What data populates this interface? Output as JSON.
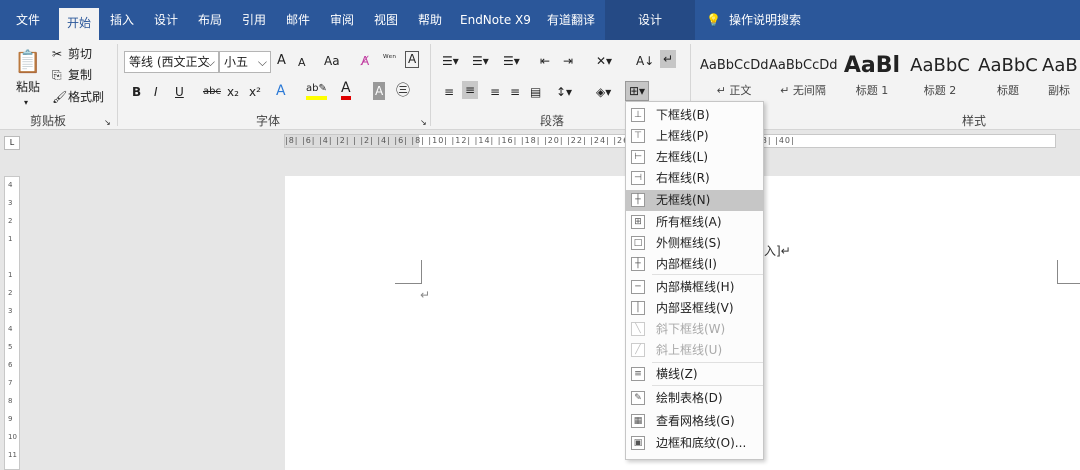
{
  "tabs": [
    "文件",
    "开始",
    "插入",
    "设计",
    "布局",
    "引用",
    "邮件",
    "审阅",
    "视图",
    "帮助",
    "EndNote X9",
    "有道翻译"
  ],
  "active_tab": "开始",
  "context_tab": "设计",
  "tell_me": "操作说明搜索",
  "clipboard": {
    "paste": "粘贴",
    "cut": "剪切",
    "copy": "复制",
    "format_painter": "格式刷",
    "label": "剪贴板"
  },
  "font": {
    "name": "等线 (西文正文",
    "size": "小五",
    "grow": "A",
    "shrink": "A",
    "case": "Aa",
    "bold": "B",
    "italic": "I",
    "underline": "U",
    "strike": "abc",
    "sub": "x₂",
    "sup": "x²",
    "label": "字体"
  },
  "paragraph": {
    "label": "段落"
  },
  "styles": {
    "items": [
      {
        "sample": "AaBbCcDd",
        "name": "↵ 正文"
      },
      {
        "sample": "AaBbCcDd",
        "name": "↵ 无间隔"
      },
      {
        "sample": "AaBl",
        "name": "标题 1"
      },
      {
        "sample": "AaBbC",
        "name": "标题 2"
      },
      {
        "sample": "AaBbC",
        "name": "标题"
      },
      {
        "sample": "AaB",
        "name": "副标"
      }
    ],
    "label": "样式"
  },
  "ruler": {
    "marks": "|8| |6| |4| |2| |  |2| |4| |6| |8| |10| |12| |14| |16| |18| |20| |22| |24| |26| |28| |30| |32| |34| |36| |38| |40|"
  },
  "vruler": {
    "marks": [
      "4",
      "3",
      "2",
      "1",
      "",
      "1",
      "2",
      "3",
      "4",
      "5",
      "6",
      "7",
      "8",
      "9",
      "10",
      "11"
    ]
  },
  "document": {
    "para1": "↵",
    "fragment": "入]↵"
  },
  "border_menu": {
    "items": [
      {
        "label": "下框线(B)",
        "icon": "bottom-border-icon",
        "state": "normal"
      },
      {
        "label": "上框线(P)",
        "icon": "top-border-icon",
        "state": "normal"
      },
      {
        "label": "左框线(L)",
        "icon": "left-border-icon",
        "state": "normal"
      },
      {
        "label": "右框线(R)",
        "icon": "right-border-icon",
        "state": "normal"
      },
      {
        "label": "无框线(N)",
        "icon": "no-border-icon",
        "state": "highlighted"
      },
      {
        "label": "所有框线(A)",
        "icon": "all-borders-icon",
        "state": "normal"
      },
      {
        "label": "外侧框线(S)",
        "icon": "outside-borders-icon",
        "state": "normal"
      },
      {
        "label": "内部框线(I)",
        "icon": "inside-borders-icon",
        "state": "normal"
      },
      {
        "label": "内部横框线(H)",
        "icon": "inside-horizontal-border-icon",
        "state": "normal"
      },
      {
        "label": "内部竖框线(V)",
        "icon": "inside-vertical-border-icon",
        "state": "normal"
      },
      {
        "label": "斜下框线(W)",
        "icon": "diagonal-down-border-icon",
        "state": "disabled"
      },
      {
        "label": "斜上框线(U)",
        "icon": "diagonal-up-border-icon",
        "state": "disabled"
      },
      {
        "label": "横线(Z)",
        "icon": "horizontal-line-icon",
        "state": "normal"
      },
      {
        "label": "绘制表格(D)",
        "icon": "draw-table-icon",
        "state": "normal"
      },
      {
        "label": "查看网格线(G)",
        "icon": "view-gridlines-icon",
        "state": "normal"
      },
      {
        "label": "边框和底纹(O)...",
        "icon": "borders-shading-icon",
        "state": "normal"
      }
    ]
  },
  "colors": {
    "accent": "#2b579a",
    "highlight": "#c6c6c6",
    "font_red": "#e00000",
    "highlight_yellow": "#ffff00"
  }
}
